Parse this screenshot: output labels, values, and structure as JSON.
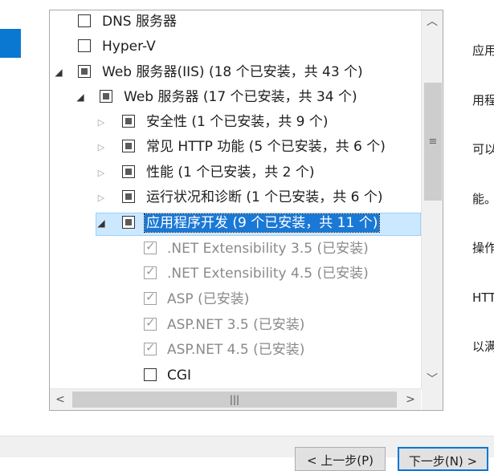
{
  "tree": {
    "items": [
      {
        "label": "DNS 服务器",
        "checkbox": "unchecked",
        "expander": "none",
        "level": 0
      },
      {
        "label": "Hyper-V",
        "checkbox": "unchecked",
        "expander": "none",
        "level": 0
      },
      {
        "label": "Web 服务器(IIS) (18 个已安装，共 43 个)",
        "checkbox": "partial",
        "expander": "expanded",
        "level": 0
      },
      {
        "label": "Web 服务器 (17 个已安装，共 34 个)",
        "checkbox": "partial",
        "expander": "expanded",
        "level": 1
      },
      {
        "label": "安全性 (1 个已安装，共 9 个)",
        "checkbox": "partial",
        "expander": "collapsed",
        "level": 2
      },
      {
        "label": "常见 HTTP 功能 (5 个已安装，共 6 个)",
        "checkbox": "partial",
        "expander": "collapsed",
        "level": 2
      },
      {
        "label": "性能 (1 个已安装，共 2 个)",
        "checkbox": "partial",
        "expander": "collapsed",
        "level": 2
      },
      {
        "label": "运行状况和诊断 (1 个已安装，共 6 个)",
        "checkbox": "partial",
        "expander": "collapsed",
        "level": 2
      },
      {
        "label": "应用程序开发 (9 个已安装，共 11 个)",
        "checkbox": "partial",
        "expander": "expanded",
        "level": 2,
        "selected": true
      },
      {
        "label": ".NET Extensibility 3.5 (已安装)",
        "checkbox": "checked-disabled",
        "expander": "none",
        "level": 3
      },
      {
        "label": ".NET Extensibility 4.5 (已安装)",
        "checkbox": "checked-disabled",
        "expander": "none",
        "level": 3
      },
      {
        "label": "ASP (已安装)",
        "checkbox": "checked-disabled",
        "expander": "none",
        "level": 3
      },
      {
        "label": "ASP.NET 3.5 (已安装)",
        "checkbox": "checked-disabled",
        "expander": "none",
        "level": 3
      },
      {
        "label": "ASP.NET 4.5 (已安装)",
        "checkbox": "checked-disabled",
        "expander": "none",
        "level": 3
      },
      {
        "label": "CGI",
        "checkbox": "unchecked",
        "expander": "none",
        "level": 3
      }
    ]
  },
  "description": {
    "lines": [
      "应用",
      "用程",
      "可以",
      "能。",
      "操作",
      "HTT",
      "以满"
    ]
  },
  "footer": {
    "prev_label": "< 上一步(P)",
    "next_label": "下一步(N) >"
  },
  "colors": {
    "accent": "#0a78d1",
    "selection": "#1a78d6"
  }
}
